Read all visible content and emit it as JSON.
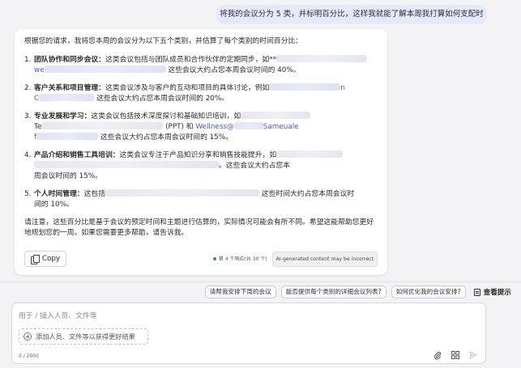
{
  "user_message": "将我的会议分为 5 类，并标明百分比，这样我就能了解本周我打算如何支配时间。",
  "answer": {
    "intro": "根据您的请求，我将您本周的会议分为以下五个类别，并估算了每个类别的时间百分比：",
    "items": [
      {
        "num": "1.",
        "title": "团队协作和同步会议：",
        "text_a": "这类会议包括与团队成员和合作伙伴的定期同步，如**",
        "link_a": "we",
        "text_b": "这些会议大约占您本周会议时间的 40%。"
      },
      {
        "num": "2.",
        "title": "客户关系和项目管理：",
        "text_a": "这类会议涉及与客户的互动和项目的具体讨论，例如",
        "link_end": "n",
        "link_a": "C",
        "text_b": "这些会议大约占您本周会议时间的 20%。"
      },
      {
        "num": "3.",
        "title": "专业发展和学习：",
        "text_a": "这类会议包括技术深度探讨和基础知识培训，如",
        "text_te": "Te",
        "text_ppt": "(PPT) 和",
        "link_b": "Wellness@",
        "link_end": "Sameuale",
        "link_f": "f",
        "text_b": "这些会议大约占您本周会议时间的 15%。"
      },
      {
        "num": "4.",
        "title": "产品介绍和销售工具培训：",
        "text_a": "这类会议专注于产品知识分享和销售技能提升，如",
        "text_b": "。这些会议大约占您本",
        "text_c": "周会议时间的 15%。"
      },
      {
        "num": "5.",
        "title": "个人时间管理：",
        "text_a": "这包括",
        "text_b": "这些时间大约占您本周会议时",
        "text_c": "间的 10%。"
      }
    ],
    "note": "请注意，这些百分比是基于会议的预定时间和主题进行估算的，实际情况可能会有所不同。希望这能帮助您更好地规划您的一周。如果您需要更多帮助，请告诉我。",
    "copy_label": "Copy",
    "response_count": "第 4 个响应(共 30 个)",
    "ai_badge": "AI-generated content may be incorrect"
  },
  "suggestions": [
    "请帮我安排下周的会议",
    "能否提供每个类别的详细会议列表?",
    "如何优化我的会议安排?"
  ],
  "view_prompts_label": "查看提示",
  "composer": {
    "placeholder": "用于 / 插入人员、文件等",
    "add_people_label": "添加人员、文件等以获得更好结果",
    "char_count": "0 / 2000"
  },
  "icons": {
    "copy": "copy-icon",
    "attach": "paperclip-icon",
    "apps": "apps-icon",
    "send": "send-icon",
    "prompts": "prompt-book-icon",
    "add": "plus-circle-icon"
  },
  "colors": {
    "accent": "#4f5bb3",
    "status_green": "#2e9b52"
  }
}
